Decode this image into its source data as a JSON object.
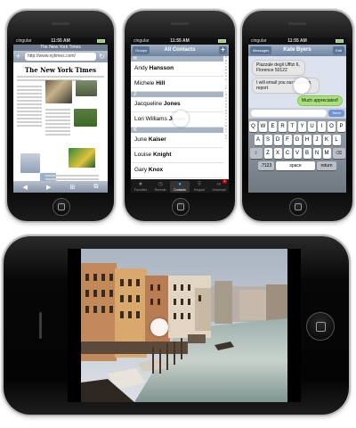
{
  "colors": {
    "bezel": "#0b0b0b",
    "navbar_blue": "#7c8fa8",
    "bubble_green": "#a8e07a",
    "bubble_gray": "#e6e6e6",
    "sky": "#cfd6e0",
    "water": "#8aa29c"
  },
  "status_bar": {
    "carrier": "cingular",
    "time": "11:55 AM"
  },
  "safari": {
    "page_title": "The New York Times",
    "url": "http://www.nytimes.com/",
    "logo_text": "The New York Times",
    "icons": [
      "plus-icon",
      "reload-icon",
      "back-icon",
      "forward-icon",
      "bookmarks-icon",
      "pages-icon"
    ],
    "toolbar_glyphs": {
      "back": "◀",
      "forward": "▶",
      "bookmarks": "⊞",
      "pages": "⧉"
    }
  },
  "contacts": {
    "groups_label": "Groups",
    "title": "All Contacts",
    "add_glyph": "+",
    "sections": [
      {
        "letter": "H",
        "rows": [
          {
            "first": "Andy",
            "last": "Hansson"
          },
          {
            "first": "Michele",
            "last": "Hill"
          }
        ]
      },
      {
        "letter": "J",
        "rows": [
          {
            "first": "Jacqueline",
            "last": "Jones"
          },
          {
            "first": "Lori Williams",
            "last": "Jones"
          }
        ]
      },
      {
        "letter": "K",
        "rows": [
          {
            "first": "June",
            "last": "Kaiser"
          },
          {
            "first": "Louise",
            "last": "Knight"
          },
          {
            "first": "Gary",
            "last": "Knox"
          }
        ]
      }
    ],
    "index_letters": "ABCDEFGHIJKLMNOPQRSTUVWXYZ#",
    "tabs": [
      {
        "label": "Favorites",
        "icon": "★",
        "icon_name": "star-icon"
      },
      {
        "label": "Recents",
        "icon": "◷",
        "icon_name": "clock-icon"
      },
      {
        "label": "Contacts",
        "icon": "●",
        "icon_name": "person-icon",
        "active": true
      },
      {
        "label": "Keypad",
        "icon": "⠿",
        "icon_name": "keypad-icon"
      },
      {
        "label": "Voicemail",
        "icon": "∞",
        "icon_name": "voicemail-icon",
        "badge": "1"
      }
    ]
  },
  "sms": {
    "back_label": "Messages",
    "title": "Kate Byers",
    "edit_label": "Edit",
    "messages": [
      {
        "dir": "in",
        "text": "Piazzale degli Uffizi 6, Florence 50122"
      },
      {
        "dir": "in",
        "text": "I will email you our vacation report"
      },
      {
        "dir": "out",
        "text": "Much appreciated!"
      }
    ],
    "send_label": "Send",
    "keyboard": {
      "row1": [
        "Q",
        "W",
        "E",
        "R",
        "T",
        "Y",
        "U",
        "I",
        "O",
        "P"
      ],
      "row2": [
        "A",
        "S",
        "D",
        "F",
        "G",
        "H",
        "J",
        "K",
        "L"
      ],
      "row3": [
        "Z",
        "X",
        "C",
        "V",
        "B",
        "N",
        "M"
      ],
      "shift_glyph": "⇧",
      "delete_glyph": "⌫",
      "num_label": ".?123",
      "space_label": "space",
      "return_label": "return"
    }
  },
  "photo": {
    "subject": "Venice canal with gondolas"
  }
}
